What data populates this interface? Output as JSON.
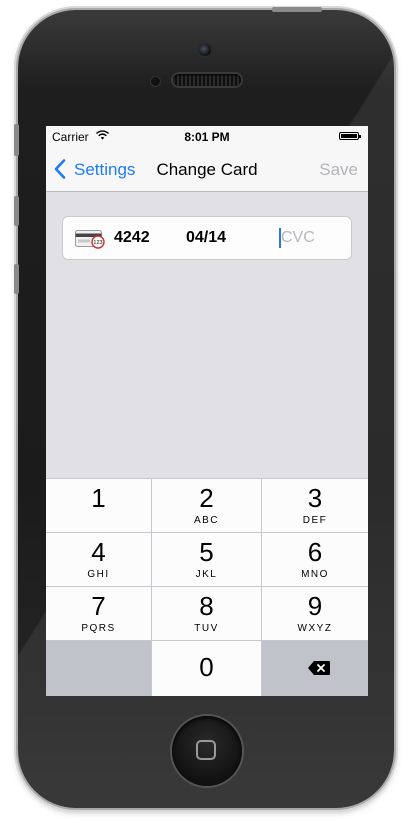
{
  "status_bar": {
    "carrier": "Carrier",
    "time": "8:01 PM"
  },
  "nav_bar": {
    "back_label": "Settings",
    "title": "Change Card",
    "save_label": "Save"
  },
  "card_field": {
    "last4": "4242",
    "expiry": "04/14",
    "cvc_value": "",
    "cvc_placeholder": "CVC",
    "card_icon": "card-back-cvc-icon"
  },
  "keypad": {
    "keys": [
      {
        "digit": "1",
        "letters": ""
      },
      {
        "digit": "2",
        "letters": "ABC"
      },
      {
        "digit": "3",
        "letters": "DEF"
      },
      {
        "digit": "4",
        "letters": "GHI"
      },
      {
        "digit": "5",
        "letters": "JKL"
      },
      {
        "digit": "6",
        "letters": "MNO"
      },
      {
        "digit": "7",
        "letters": "PQRS"
      },
      {
        "digit": "8",
        "letters": "TUV"
      },
      {
        "digit": "9",
        "letters": "WXYZ"
      },
      {
        "digit": "0",
        "letters": ""
      }
    ],
    "delete_icon": "backspace-icon"
  },
  "colors": {
    "accent": "#1e7cf5",
    "save_disabled": "#b4b4b9",
    "placeholder": "#b8b8c0",
    "cursor": "#2a74f0",
    "keypad_bg": "#c5c8cd",
    "screen_bg": "#e0e0e5"
  }
}
